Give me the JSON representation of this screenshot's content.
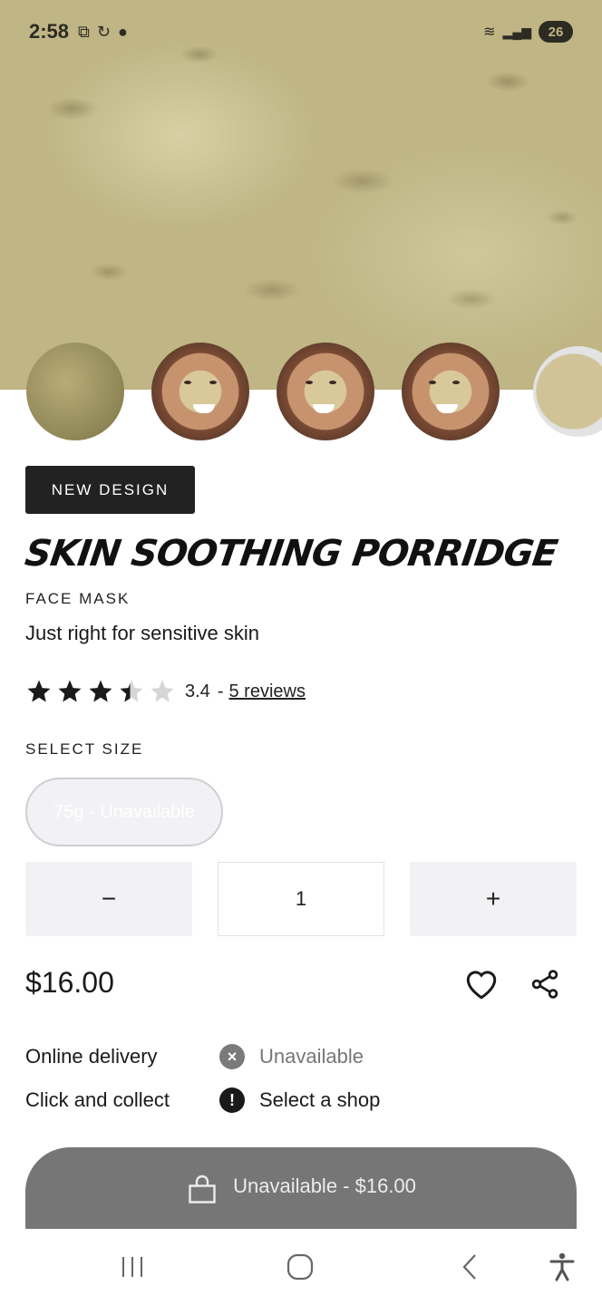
{
  "status_bar": {
    "time": "2:58",
    "battery": "26"
  },
  "product": {
    "badge": "NEW DESIGN",
    "name": "SKIN SOOTHING PORRIDGE",
    "category": "FACE MASK",
    "tagline": "Just right for sensitive skin",
    "rating_value": "3.4",
    "rating_separator": "-",
    "rating_stars": 3.4,
    "reviews_link": "5 reviews",
    "price": "$16.00"
  },
  "size": {
    "heading": "SELECT SIZE",
    "option": "75g - Unavailable"
  },
  "quantity": {
    "minus": "−",
    "value": "1",
    "plus": "+"
  },
  "availability": [
    {
      "label": "Online delivery",
      "icon": "x-circle-icon",
      "status": "Unavailable"
    },
    {
      "label": "Click and collect",
      "icon": "exclamation-circle-icon",
      "status": "Select a shop"
    }
  ],
  "cart_button": {
    "label": "Unavailable - $16.00"
  },
  "colors": {
    "badge_bg": "#222222",
    "cart_button_bg": "#767676",
    "qty_bg": "#f2f1f4",
    "muted_text": "#777777"
  }
}
